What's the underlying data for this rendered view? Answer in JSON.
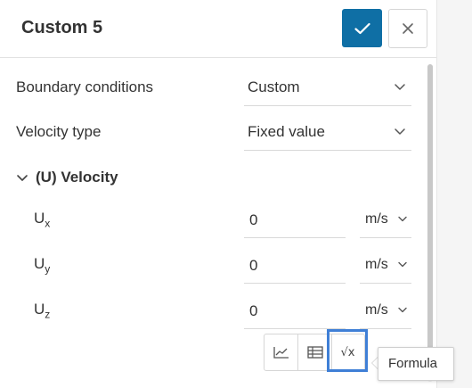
{
  "header": {
    "title": "Custom 5"
  },
  "fields": {
    "boundary_conditions": {
      "label": "Boundary conditions",
      "value": "Custom"
    },
    "velocity_type": {
      "label": "Velocity type",
      "value": "Fixed value"
    }
  },
  "section": {
    "label": "(U) Velocity"
  },
  "components": [
    {
      "base": "U",
      "sub": "x",
      "value": "0",
      "unit": "m/s"
    },
    {
      "base": "U",
      "sub": "y",
      "value": "0",
      "unit": "m/s"
    },
    {
      "base": "U",
      "sub": "z",
      "value": "0",
      "unit": "m/s"
    }
  ],
  "toolbar": {
    "buttons": [
      {
        "icon": "line-chart-icon"
      },
      {
        "icon": "table-icon"
      },
      {
        "icon": "formula-icon",
        "glyph": "√x",
        "active": true
      }
    ]
  },
  "tooltip": {
    "text": "Formula"
  },
  "colors": {
    "accent": "#0f6fa5",
    "highlight": "#3f7fd6"
  }
}
